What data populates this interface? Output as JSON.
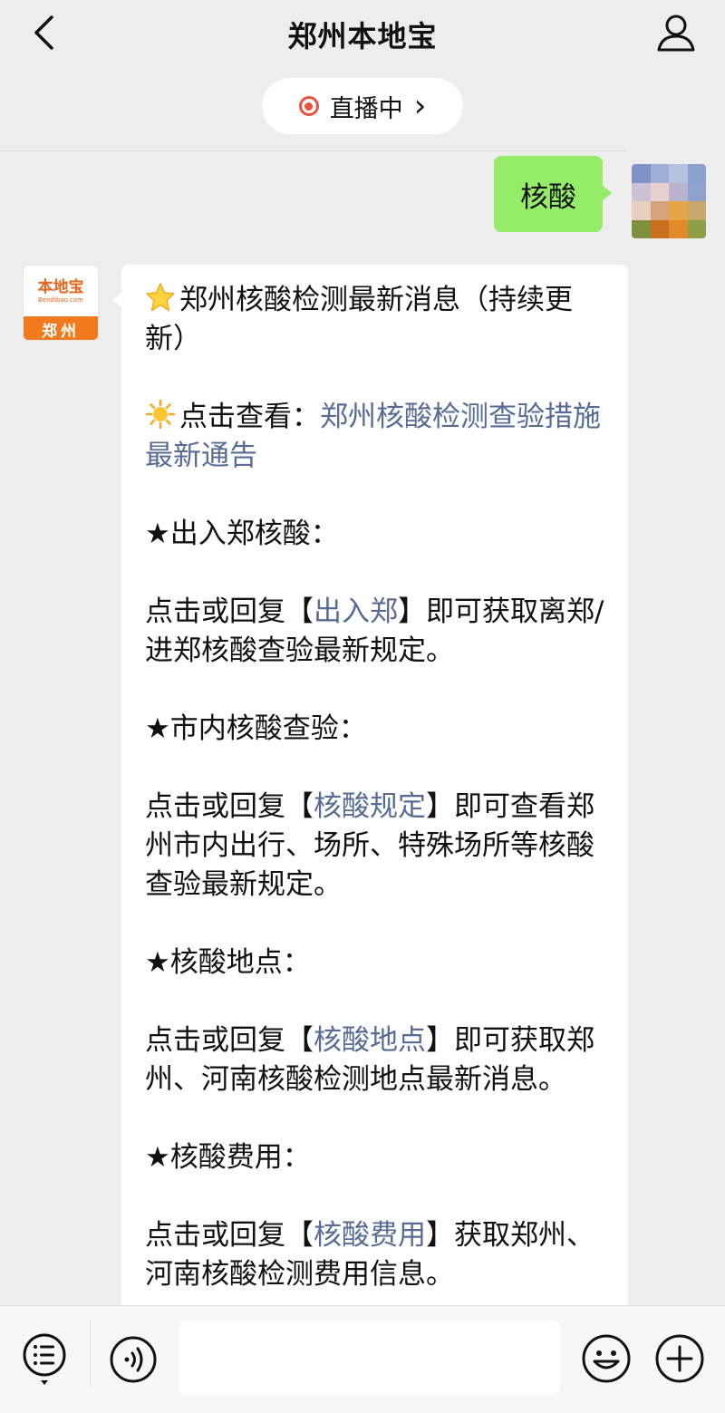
{
  "header": {
    "title": "郑州本地宝",
    "back_icon": "chevron-left-icon",
    "user_icon": "user-icon"
  },
  "live": {
    "label": "直播中",
    "arrow": "›"
  },
  "sent_message": {
    "text": "核酸"
  },
  "bot_avatar": {
    "name": "本地宝",
    "url": "Bendibao.com",
    "city": "郑州"
  },
  "message": {
    "intro": {
      "emoji": "star-emoji",
      "text": "郑州核酸检测最新消息（持续更新）"
    },
    "notice": {
      "emoji": "sun-emoji",
      "prefix": "点击查看：",
      "link": "郑州核酸检测查验措施最新通告"
    },
    "sections": [
      {
        "heading": "★出入郑核酸：",
        "pre": "点击或回复【",
        "link": "出入郑",
        "post": "】即可获取离郑/进郑核酸查验最新规定。"
      },
      {
        "heading": "★市内核酸查验：",
        "pre": "点击或回复【",
        "link": "核酸规定",
        "post": "】即可查看郑州市内出行、场所、特殊场所等核酸查验最新规定。"
      },
      {
        "heading": "★核酸地点：",
        "pre": "点击或回复【",
        "link": "核酸地点",
        "post": "】即可获取郑州、河南核酸检测地点最新消息。"
      },
      {
        "heading": "★核酸费用：",
        "pre": "点击或回复【",
        "link": "核酸费用",
        "post": "】获取郑州、河南核酸检测费用信息。"
      }
    ]
  },
  "bottom_bar": {
    "menu_icon": "menu-list-icon",
    "voice_icon": "voice-icon",
    "input_placeholder": "",
    "emoji_icon": "emoji-icon",
    "plus_icon": "plus-icon"
  },
  "colors": {
    "accent_link": "#576b95",
    "sent_bubble": "#95ec69",
    "live_red": "#e8533f",
    "brand_orange": "#f07a1d"
  }
}
